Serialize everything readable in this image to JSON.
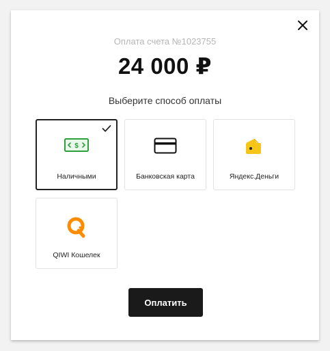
{
  "modal": {
    "invoice_label": "Оплата счета №1023755",
    "amount": "24 000 ₽",
    "choose_label": "Выберите способ оплаты",
    "pay_button_label": "Оплатить"
  },
  "payment_methods": [
    {
      "label": "Наличными",
      "icon": "cash-icon",
      "selected": true
    },
    {
      "label": "Банковская карта",
      "icon": "credit-card-icon",
      "selected": false
    },
    {
      "label": "Яндекс.Деньги",
      "icon": "yandex-money-wallet-icon",
      "selected": false
    },
    {
      "label": "QIWI Кошелек",
      "icon": "qiwi-logo-icon",
      "selected": false
    }
  ],
  "colors": {
    "cash_green": "#2e9e3c",
    "yandex_yellow": "#f5c518",
    "qiwi_orange": "#ff8c00",
    "button_bg": "#1a1a1a",
    "selected_border": "#222222"
  }
}
